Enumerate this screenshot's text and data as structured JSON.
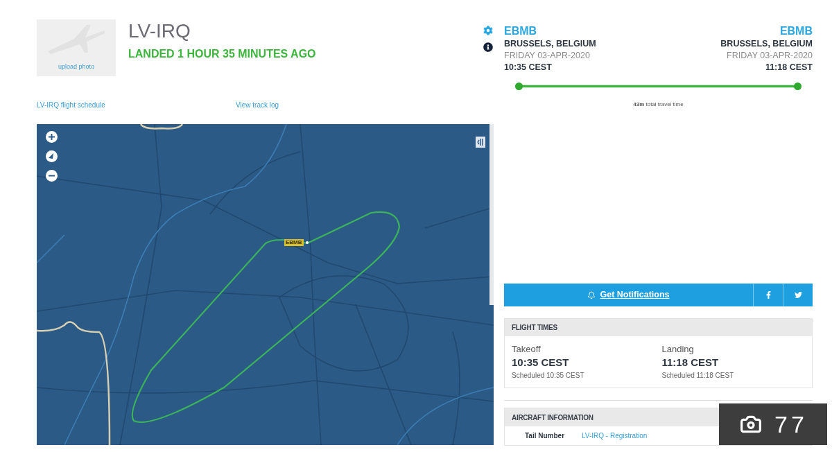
{
  "aircraft": {
    "photo": {
      "link": "upload photo"
    },
    "registration": "LV-IRQ",
    "status": "LANDED 1 HOUR 35 MINUTES AGO"
  },
  "links": [
    "LV-IRQ flight schedule",
    "View track log"
  ],
  "map": {
    "airport_label": "EBMB"
  },
  "route": {
    "origin": {
      "code": "EBMB",
      "city": "BRUSSELS, BELGIUM",
      "date": "FRIDAY 03-APR-2020",
      "time": "10:35 CEST"
    },
    "destination": {
      "code": "EBMB",
      "city": "BRUSSELS, BELGIUM",
      "date": "FRIDAY 03-APR-2020",
      "time": "11:18 CEST"
    },
    "progress": {
      "level": 1
    },
    "travel_time": "**43m** total travel time"
  },
  "notifications": {
    "label": "Get Notifications",
    "share_buttons": [
      {
        "kind": "facebook"
      },
      {
        "kind": "twitter"
      }
    ]
  },
  "flight_times": {
    "title": "FLIGHT TIMES",
    "columns": [
      {
        "label": "Takeoff",
        "time": "10:35 CEST",
        "scheduled": "Scheduled 10:35 CEST"
      },
      {
        "label": "Landing",
        "time": "11:18 CEST",
        "scheduled": "Scheduled 11:18 CEST"
      }
    ]
  },
  "aircraft_information": {
    "title": "AIRCRAFT INFORMATION",
    "rows": [
      {
        "label": "Tail Number",
        "value": "LV-IRQ - Registration"
      }
    ]
  },
  "photo_badge": {
    "count": "77"
  }
}
